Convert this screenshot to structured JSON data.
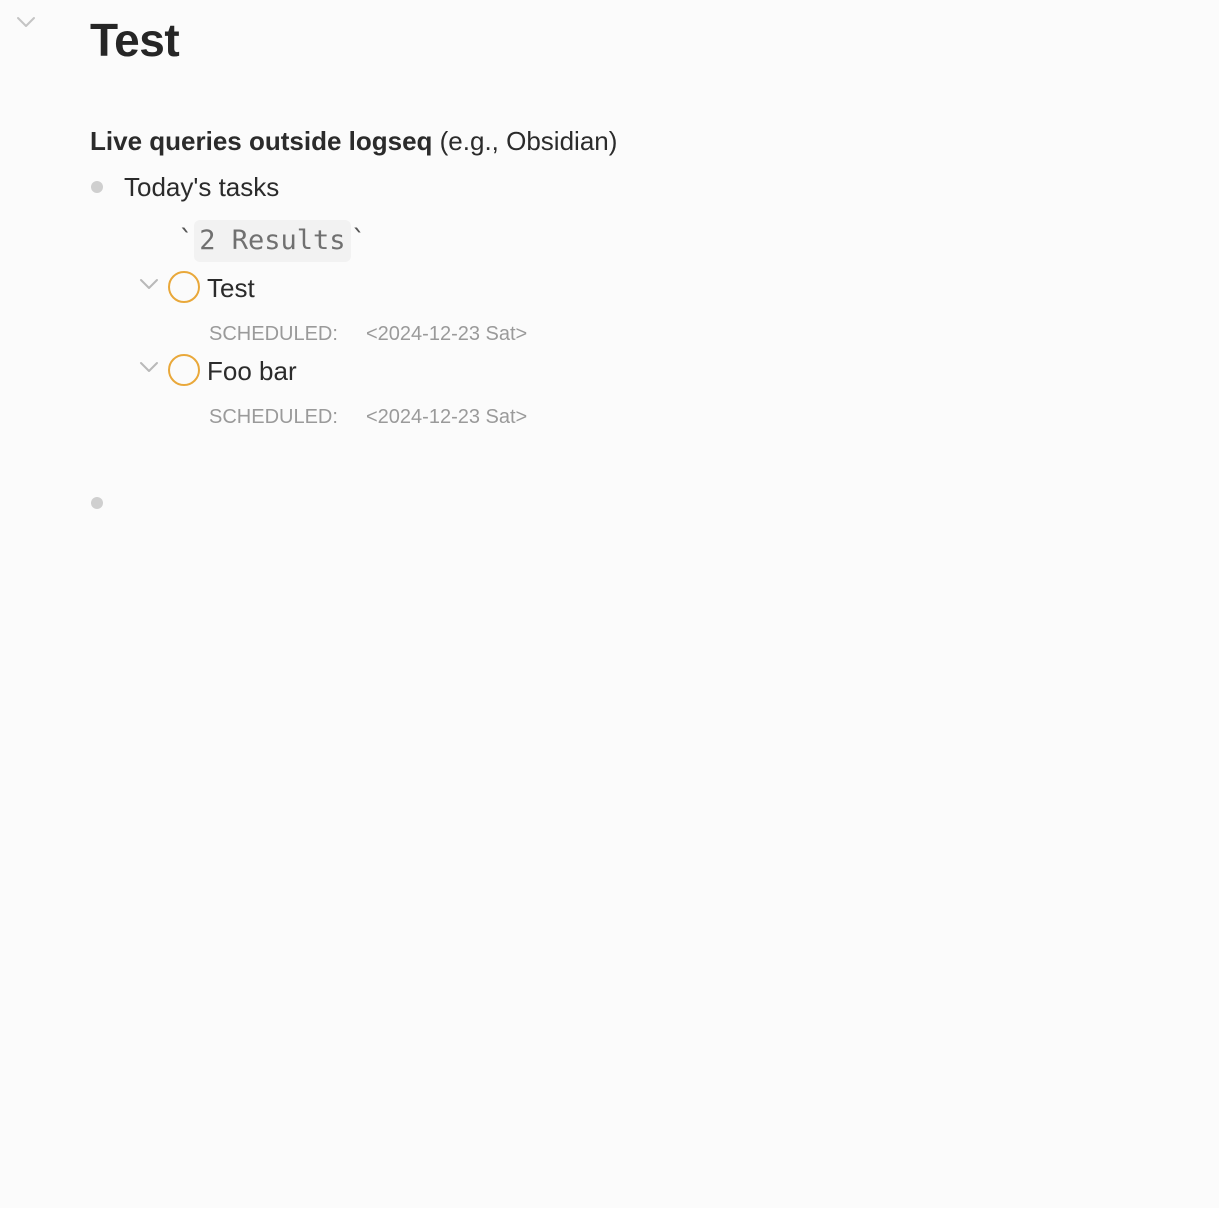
{
  "page": {
    "title": "Test"
  },
  "heading": {
    "bold": "Live queries outside logseq",
    "normal": " (e.g., Obsidian)"
  },
  "block": {
    "text": "Today's tasks"
  },
  "query": {
    "tick_open": "`",
    "results": "2 Results",
    "tick_close": "`"
  },
  "tasks": [
    {
      "title": "Test",
      "scheduled_label": "SCHEDULED:",
      "scheduled_value": "<2024-12-23 Sat>"
    },
    {
      "title": "Foo bar",
      "scheduled_label": "SCHEDULED:",
      "scheduled_value": "<2024-12-23 Sat>"
    }
  ],
  "colors": {
    "todo_circle": "#e9a83a",
    "bullet": "#cfcfcf",
    "muted_text": "#9a9a9a",
    "background": "#fbfbfb"
  },
  "icons": {
    "page_collapse": "chevron-down-icon",
    "task_collapse": "chevron-down-icon",
    "task_marker": "todo-circle-icon",
    "block_bullet": "bullet-dot-icon"
  }
}
